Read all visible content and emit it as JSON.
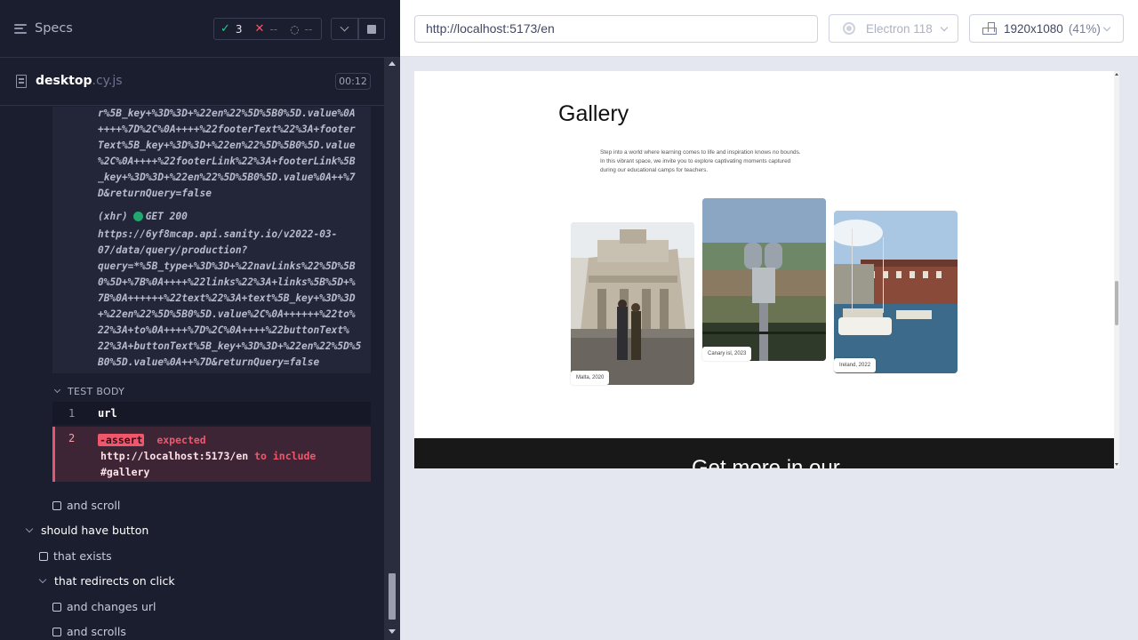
{
  "reporter": {
    "specs_label": "Specs",
    "stats": {
      "passed": "3",
      "failed": "--",
      "pending": "--"
    },
    "file": {
      "name": "desktop",
      "ext": ".cy.js",
      "time": "00:12"
    },
    "log_top": "r%5B_key+%3D%3D+%22en%22%5D%5B0%5D.value%0A\n++++%7D%2C%0A++++%22footerText%22%3A+footer\nText%5B_key+%3D%3D+%22en%22%5D%5B0%5D.value\n%2C%0A++++%22footerLink%22%3A+footerLink%5B\n_key+%3D%3D+%22en%22%5D%5B0%5D.value%0A++%7\nD&returnQuery=false",
    "xhr_prefix": "(xhr)",
    "xhr_status": "GET 200",
    "log_bottom": "https://6yf8mcap.api.sanity.io/v2022-03-\n07/data/query/production?\nquery=*%5B_type+%3D%3D+%22navLinks%22%5D%5B\n0%5D+%7B%0A++++%22links%22%3A+links%5B%5D+%\n7B%0A++++++%22text%22%3A+text%5B_key+%3D%3D\n+%22en%22%5D%5B0%5D.value%2C%0A++++++%22to%\n22%3A+to%0A++++%7D%2C%0A++++%22buttonText%\n22%3A+buttonText%5B_key+%3D%3D+%22en%22%5D%5\nB0%5D.value%0A++%7D&returnQuery=false",
    "test_body_label": "TEST BODY",
    "commands": [
      {
        "num": "1",
        "name": "url"
      },
      {
        "num": "2",
        "name": "-assert",
        "word": "expected",
        "url": "http://localhost:5173/en",
        "to_include": "to include",
        "target": "#gallery"
      }
    ],
    "tree": [
      {
        "label": "and scroll",
        "kind": "test"
      },
      {
        "label": "should have button",
        "kind": "suite"
      },
      {
        "label": "that exists",
        "kind": "test"
      },
      {
        "label": "that redirects on click",
        "kind": "suite"
      },
      {
        "label": "and changes url",
        "kind": "test"
      },
      {
        "label": "and scrolls",
        "kind": "test"
      }
    ]
  },
  "aut": {
    "url": "http://localhost:5173/en",
    "browser": "Electron 118",
    "viewport": "1920x1080",
    "viewport_pct": "(41%)",
    "page": {
      "title": "Gallery",
      "description": "Step into a world where learning comes to life and inspiration knows no bounds. In this vibrant space, we invite you to explore captivating moments captured during our educational camps for teachers.",
      "photos": [
        {
          "caption": "Malta, 2020",
          "icon": "building-photo"
        },
        {
          "caption": "Canary isl, 2023",
          "icon": "binoculars-photo"
        },
        {
          "caption": "Ireland, 2022",
          "icon": "harbor-photo"
        }
      ],
      "footer_text": "Get more in our"
    }
  },
  "colors": {
    "pass": "#33c29a",
    "fail": "#f0576b",
    "panel": "#1b1e2e"
  }
}
